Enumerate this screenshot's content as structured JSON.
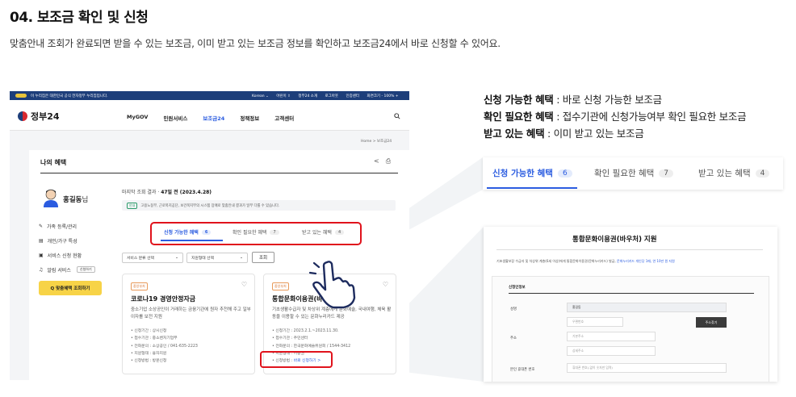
{
  "section": {
    "title": "04. 보조금 확인 및 신청",
    "description": "맞춤안내 조회가 완료되면 받을 수 있는 보조금, 이미 받고 있는 보조금 정보를 확인하고 보조금24에서 바로 신청할 수 있어요."
  },
  "gov_banner": {
    "notice": "이 누리집은 대한민국 공식 전자정부 누리집입니다.",
    "links": [
      "Korean ⌄",
      "어린이 ⇧",
      "정부24 소개",
      "로그아웃",
      "인증센터",
      "화면크기 - 100% +"
    ]
  },
  "header": {
    "logo": "정부24",
    "nav": [
      "MyGOV",
      "민원서비스",
      "보조금24",
      "정책정보",
      "고객센터"
    ],
    "active_nav": "보조금24",
    "breadcrumb": "Home  >  보조금24"
  },
  "page": {
    "heading": "나의 혜택",
    "user_name": "홍길동",
    "user_suffix": "님",
    "side_menu": [
      "가족 등록/관리",
      "개인/가구 특성",
      "서비스 신청 현황",
      "알림 서비스"
    ],
    "side_menu_mini_button": "신청하기",
    "cta_button": "Q 맞춤혜택 조회하기",
    "last_query_label": "마지막 조회 결과",
    "last_query_value": "47일 전 (2023.4.28)",
    "notice_tag": "안내",
    "notice_text": "고용노동부, 근로복지공단, 보건복지부의 시스템 장애로 맞춤안내 결과가 일부 다를 수 있습니다.",
    "tabs": [
      {
        "label": "신청 가능한 혜택",
        "count": "6"
      },
      {
        "label": "확인 필요한 혜택",
        "count": "7"
      },
      {
        "label": "받고 있는 혜택",
        "count": "4"
      }
    ],
    "filters": [
      "서비스 분류 선택",
      "지원형태 선택"
    ],
    "lookup_button": "조회",
    "cards": [
      {
        "badge": "중앙부처",
        "title": "코로나19 경영안정자금",
        "desc": "중소기업 소상공인이 거래하는 금융기관에 원자 추천해 주고 일부 이자를 보전 지원",
        "meta": [
          "• 신청기간 : 상시신청",
          "• 접수기관 : 중소벤처기업부",
          "• 전화문의 : 소상공인 / 041-635-2223",
          "• 지원형태 : 융자지원",
          "• 신청방법 : 방문신청"
        ],
        "link_label": "",
        "link_value": ""
      },
      {
        "badge": "중앙부처",
        "title": "통합문화이용권(바우처) 지원",
        "desc": "기초생활수급자 및 차상위 계층에게 문화예술, 국내여행, 체육 활동을 이용할 수 있는 문화누리카드 제공",
        "meta": [
          "• 신청기간 : 2023.2.1.~2023.11.30.",
          "• 접수기관 : 주민센터",
          "• 전화문의 : 한국문화예술위원회 / 1544-3412",
          "• 지원형태 : 이용권"
        ],
        "link_label": "• 신청방법 : ",
        "link_value": "바로 신청하기 >"
      }
    ]
  },
  "legend": [
    {
      "term": "신청 가능한 혜택",
      "def": " : 바로 신청 가능한 보조금"
    },
    {
      "term": "확인 필요한 혜택",
      "def": " : 접수기관에 신청가능여부 확인 필요한 보조금"
    },
    {
      "term": "받고 있는 혜택",
      "def": " : 이미 받고 있는 보조금"
    }
  ],
  "zoom_tabs": [
    {
      "label": "신청 가능한 혜택",
      "count": "6"
    },
    {
      "label": "확인 필요한 혜택",
      "count": "7"
    },
    {
      "label": "받고 있는 혜택",
      "count": "4"
    }
  ],
  "zoom_form": {
    "title": "통합문화이용권(바우처) 지원",
    "desc": "기초생활보장 수급자 및 차상위 계층(6세 이상)에게 통합문화이용권(문화누리카드) 발급, ",
    "desc_link": "문화누리카드 개인당 1매, 연 10만 원 지원",
    "section": "신청인정보",
    "labels": [
      "성명",
      "주소",
      "본인 휴대폰 번호"
    ],
    "name_value": "홍길동",
    "postcode_placeholder": "우편번호",
    "find_button": "주소찾기",
    "address_placeholder": "기본주소",
    "detail_placeholder": "상세주소",
    "phone_placeholder": "휴대폰 번호(-없이 숫자만 입력)"
  },
  "colors": {
    "accent": "#2b5ce0",
    "highlight": "#e0131c",
    "cta": "#f7d347",
    "banner": "#1d3e7a"
  }
}
